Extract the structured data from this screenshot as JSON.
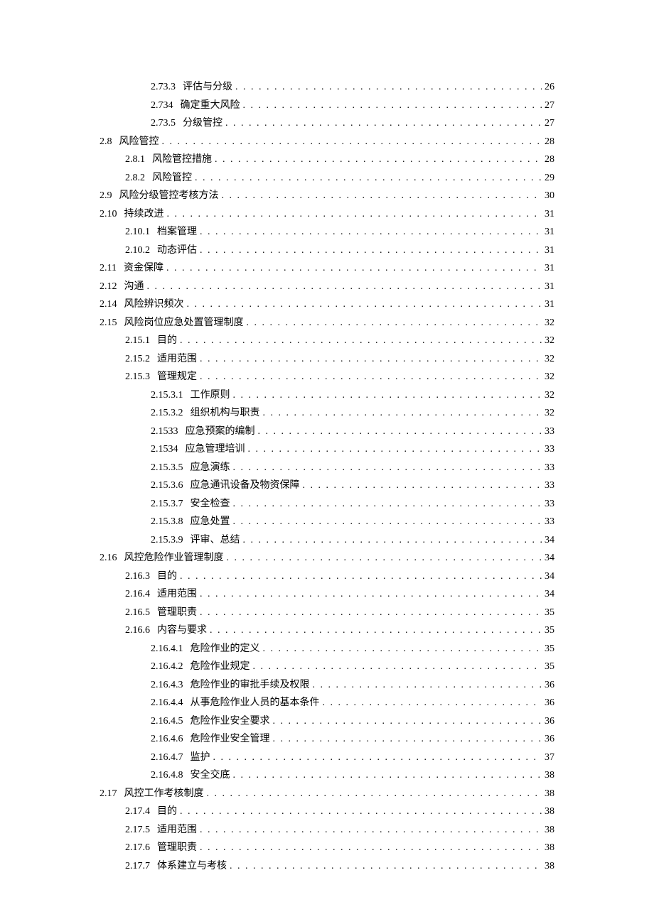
{
  "toc": [
    {
      "num": "2.73.3",
      "title": "评估与分级",
      "page": "26",
      "level": 3
    },
    {
      "num": "2.734",
      "title": "确定重大风险",
      "page": "27",
      "level": 3
    },
    {
      "num": "2.73.5",
      "title": "分级管控",
      "page": "27",
      "level": 3
    },
    {
      "num": "2.8",
      "title": "风险管控",
      "page": "28",
      "level": 1
    },
    {
      "num": "2.8.1",
      "title": "风险管控措施",
      "page": "28",
      "level": 2
    },
    {
      "num": "2.8.2",
      "title": "风险管控",
      "page": "29",
      "level": 2
    },
    {
      "num": "2.9",
      "title": "风险分级管控考核方法",
      "page": "30",
      "level": 1
    },
    {
      "num": "2.10",
      "title": "持续改进",
      "page": "31",
      "level": 1
    },
    {
      "num": "2.10.1",
      "title": "档案管理",
      "page": "31",
      "level": 2
    },
    {
      "num": "2.10.2",
      "title": "动态评估",
      "page": "31",
      "level": 2
    },
    {
      "num": "2.11",
      "title": "资金保障",
      "page": "31",
      "level": 1
    },
    {
      "num": "2.12",
      "title": "沟通",
      "page": "31",
      "level": 1
    },
    {
      "num": "2.14",
      "title": "风险辨识频次",
      "page": "31",
      "level": 1
    },
    {
      "num": "2.15",
      "title": "风险岗位应急处置管理制度",
      "page": "32",
      "level": 1
    },
    {
      "num": "2.15.1",
      "title": "目的",
      "page": "32",
      "level": 2
    },
    {
      "num": "2.15.2",
      "title": "适用范围",
      "page": "32",
      "level": 2
    },
    {
      "num": "2.15.3",
      "title": "管理规定",
      "page": "32",
      "level": 2
    },
    {
      "num": "2.15.3.1",
      "title": "工作原则",
      "page": "32",
      "level": 3
    },
    {
      "num": "2.15.3.2",
      "title": "组织机构与职责",
      "page": "32",
      "level": 3
    },
    {
      "num": "2.1533",
      "title": "应急预案的编制",
      "page": "33",
      "level": 3
    },
    {
      "num": "2.1534",
      "title": "应急管理培训",
      "page": "33",
      "level": 3
    },
    {
      "num": "2.15.3.5",
      "title": "应急演练",
      "page": "33",
      "level": 3
    },
    {
      "num": "2.15.3.6",
      "title": "应急通讯设备及物资保障",
      "page": "33",
      "level": 3
    },
    {
      "num": "2.15.3.7",
      "title": "安全检查",
      "page": "33",
      "level": 3
    },
    {
      "num": "2.15.3.8",
      "title": "应急处置",
      "page": "33",
      "level": 3
    },
    {
      "num": "2.15.3.9",
      "title": "评审、总结",
      "page": "34",
      "level": 3
    },
    {
      "num": "2.16",
      "title": "风控危险作业管理制度",
      "page": "34",
      "level": 1
    },
    {
      "num": "2.16.3",
      "title": "目的",
      "page": "34",
      "level": 2
    },
    {
      "num": "2.16.4",
      "title": "适用范围",
      "page": "34",
      "level": 2
    },
    {
      "num": "2.16.5",
      "title": "管理职责",
      "page": "35",
      "level": 2
    },
    {
      "num": "2.16.6",
      "title": "内容与要求",
      "page": "35",
      "level": 2
    },
    {
      "num": "2.16.4.1",
      "title": "危险作业的定义",
      "page": "35",
      "level": 3
    },
    {
      "num": "2.16.4.2",
      "title": "危险作业规定",
      "page": "35",
      "level": 3
    },
    {
      "num": "2.16.4.3",
      "title": "危险作业的审批手续及权限",
      "page": "36",
      "level": 3
    },
    {
      "num": "2.16.4.4",
      "title": "从事危险作业人员的基本条件",
      "page": "36",
      "level": 3
    },
    {
      "num": "2.16.4.5",
      "title": "危险作业安全要求",
      "page": "36",
      "level": 3
    },
    {
      "num": "2.16.4.6",
      "title": "危险作业安全管理",
      "page": "36",
      "level": 3
    },
    {
      "num": "2.16.4.7",
      "title": "监护",
      "page": "37",
      "level": 3
    },
    {
      "num": "2.16.4.8",
      "title": "安全交底",
      "page": "38",
      "level": 3
    },
    {
      "num": "2.17",
      "title": "风控工作考核制度",
      "page": "38",
      "level": 1
    },
    {
      "num": "2.17.4",
      "title": "目的",
      "page": "38",
      "level": 2
    },
    {
      "num": "2.17.5",
      "title": "适用范围",
      "page": "38",
      "level": 2
    },
    {
      "num": "2.17.6",
      "title": "管理职责",
      "page": "38",
      "level": 2
    },
    {
      "num": "2.17.7",
      "title": "体系建立与考核",
      "page": "38",
      "level": 2
    }
  ]
}
